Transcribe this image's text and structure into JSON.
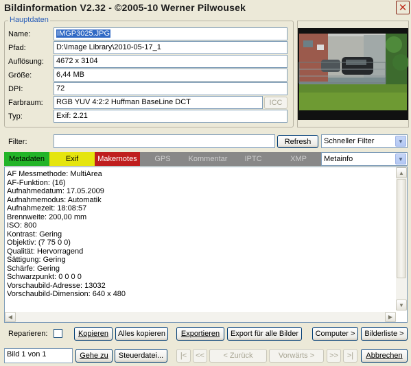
{
  "window": {
    "title": "Bildinformation V2.32 - ©2005-10 Werner Pilwousek",
    "close_glyph": "✕"
  },
  "hauptdaten": {
    "title": "Hauptdaten",
    "fields": [
      {
        "label": "Name:",
        "value": "IMGP3025.JPG"
      },
      {
        "label": "Pfad:",
        "value": "D:\\Image Library\\2010-05-17_1"
      },
      {
        "label": "Auflösung:",
        "value": "4672 x 3104"
      },
      {
        "label": "Größe:",
        "value": "6,44 MB"
      },
      {
        "label": "DPI:",
        "value": "72"
      },
      {
        "label": "Farbraum:",
        "value": "RGB YUV 4:2:2 Huffman BaseLine DCT"
      },
      {
        "label": "Typ:",
        "value": "Exif: 2.21"
      }
    ],
    "icc_label": "ICC"
  },
  "filter": {
    "label": "Filter:",
    "value": "",
    "refresh_label": "Refresh",
    "mode_selected": "Schneller Filter"
  },
  "tabs": [
    {
      "label": "Metadaten",
      "style": "green"
    },
    {
      "label": "Exif",
      "style": "yellow"
    },
    {
      "label": "Makernotes",
      "style": "red"
    },
    {
      "label": "GPS",
      "style": "grey"
    },
    {
      "label": "Kommentar",
      "style": "grey"
    },
    {
      "label": "IPTC",
      "style": "grey"
    },
    {
      "label": "XMP",
      "style": "grey"
    }
  ],
  "metainfo_selected": "Metainfo",
  "metadata_lines": [
    "AF Messmethode: MultiArea",
    "AF-Funktion: (16)",
    "Aufnahmedatum: 17.05.2009",
    "Aufnahmemodus: Automatik",
    "Aufnahmezeit: 18:08:57",
    "Brennweite: 200,00 mm",
    "ISO: 800",
    "Kontrast: Gering",
    "Objektiv: (7 75 0 0)",
    "Qualität: Hervorragend",
    "Sättigung: Gering",
    "Schärfe: Gering",
    "Schwarzpunkt: 0 0 0 0",
    "Vorschaubild-Adresse: 13032",
    "Vorschaubild-Dimension: 640 x 480"
  ],
  "actions": {
    "reparieren_label": "Reparieren:",
    "kopieren": "Kopieren",
    "alles_kopieren": "Alles kopieren",
    "exportieren": "Exportieren",
    "export_alle": "Export für alle Bilder",
    "computer": "Computer >",
    "bilderliste": "Bilderliste >"
  },
  "nav": {
    "bild_value": "Bild 1 von 1",
    "gehe_zu": "Gehe zu",
    "steuerdatei": "Steuerdatei...",
    "first": "|<",
    "prev_fast": "<<",
    "zurueck": "< Zurück",
    "vorwaerts": "Vorwärts >",
    "next_fast": ">>",
    "last": ">|",
    "abbrechen": "Abbrechen"
  },
  "colors": {
    "tab_green": "#22b428",
    "tab_yellow": "#e5e50e",
    "tab_red": "#bf1e1e",
    "tab_grey": "#888888",
    "group_title": "#2b5fb8"
  }
}
